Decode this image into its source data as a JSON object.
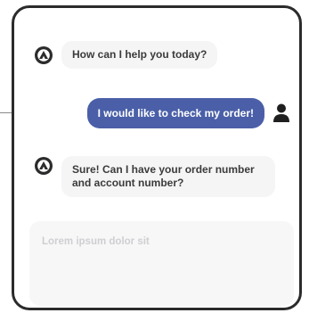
{
  "chat": {
    "messages": [
      {
        "role": "bot",
        "text": "How can I help you today?"
      },
      {
        "role": "user",
        "text": "I would like to check my order!"
      },
      {
        "role": "bot",
        "text": "Sure! Can I have your order number and account number?"
      }
    ]
  },
  "composer": {
    "placeholder": "Lorem ipsum dolor sit"
  },
  "colors": {
    "accent": "#4a5fa8",
    "bot_bubble": "#f5f5f6",
    "frame": "#2b2b2b"
  },
  "icons": {
    "bot_avatar": "bot-avatar-icon",
    "user_avatar": "user-avatar-icon"
  }
}
